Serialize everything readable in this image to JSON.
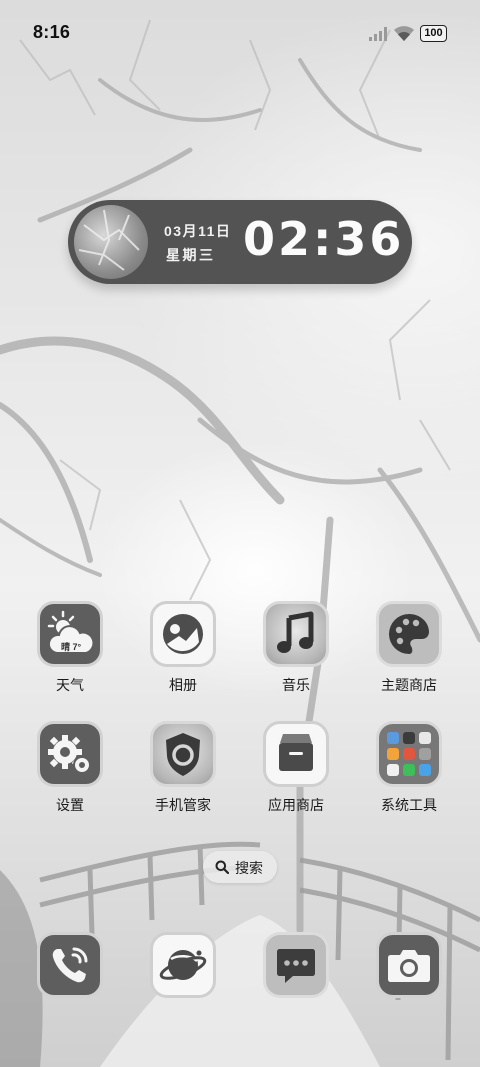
{
  "status_bar": {
    "time": "8:16",
    "battery": "100",
    "icons": [
      "signal-icon",
      "wifi-icon",
      "battery-icon"
    ]
  },
  "clock_widget": {
    "date": "03月11日",
    "weekday": "星期三",
    "time": "02:36"
  },
  "apps": {
    "row1": [
      {
        "label": "天气",
        "icon": "weather-icon",
        "temp": "晴 7°"
      },
      {
        "label": "相册",
        "icon": "gallery-icon"
      },
      {
        "label": "音乐",
        "icon": "music-icon"
      },
      {
        "label": "主题商店",
        "icon": "theme-store-icon"
      }
    ],
    "row2": [
      {
        "label": "设置",
        "icon": "settings-icon"
      },
      {
        "label": "手机管家",
        "icon": "phone-manager-icon"
      },
      {
        "label": "应用商店",
        "icon": "app-store-icon"
      },
      {
        "label": "系统工具",
        "icon": "system-tools-folder-icon"
      }
    ]
  },
  "search": {
    "label": "搜索",
    "icon": "search-icon"
  },
  "dock": [
    {
      "name": "phone",
      "icon": "phone-icon"
    },
    {
      "name": "browser",
      "icon": "browser-icon"
    },
    {
      "name": "messages",
      "icon": "messages-icon"
    },
    {
      "name": "camera",
      "icon": "camera-icon"
    }
  ],
  "colors": {
    "widget_bg": "#535353",
    "icon_dark": "#5e5e5e",
    "icon_light": "#f7f7f7",
    "icon_gray": "#bdbdbd"
  }
}
